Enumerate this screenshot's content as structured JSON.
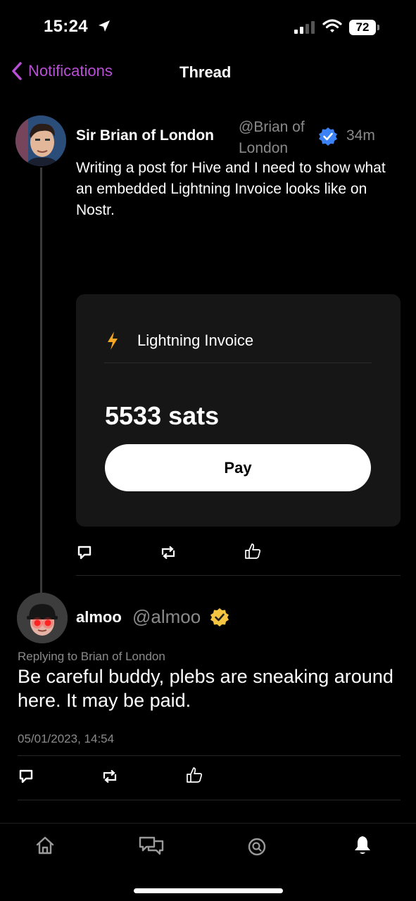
{
  "status_bar": {
    "time": "15:24",
    "battery": "72"
  },
  "nav": {
    "back_label": "Notifications",
    "title": "Thread"
  },
  "post": {
    "author_name": "Sir Brian of London",
    "author_handle": "@Brian of London",
    "time_ago": "34m",
    "text": "Writing a post for Hive and I need to show what an embedded Lightning Invoice looks like on Nostr.",
    "invoice": {
      "title": "Lightning Invoice",
      "amount": "5533 sats",
      "pay_label": "Pay"
    }
  },
  "reply": {
    "author_name": "almoo",
    "author_handle": "@almoo",
    "replying_to": "Replying to Brian of London",
    "text": "Be careful buddy, plebs are sneaking around here. It may be paid.",
    "date": "05/01/2023, 14:54"
  },
  "colors": {
    "accent": "#b84fd6",
    "verified_blue": "#3b82f6",
    "verified_gold": "#f5c542",
    "bolt": "#f5a623"
  },
  "tab_bar": {
    "icons": [
      "home-icon",
      "messages-icon",
      "search-icon",
      "bell-icon"
    ],
    "active": "bell-icon"
  }
}
